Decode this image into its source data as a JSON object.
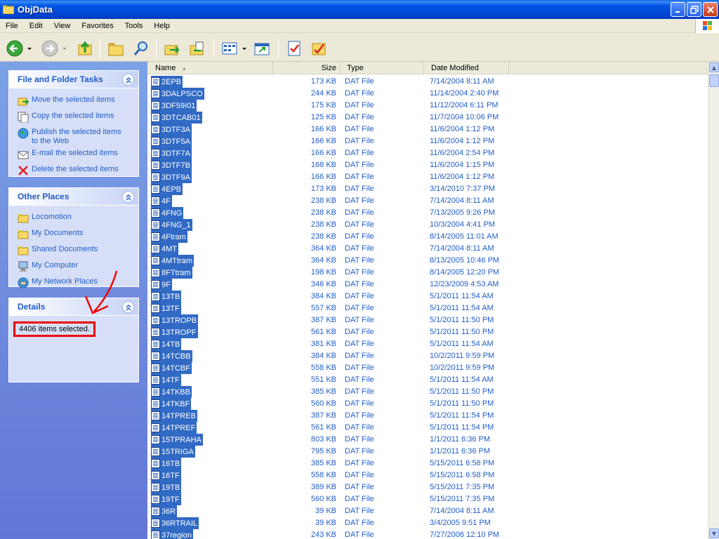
{
  "window": {
    "title": "ObjData"
  },
  "menu": [
    "File",
    "Edit",
    "View",
    "Favorites",
    "Tools",
    "Help"
  ],
  "toolbar": {
    "icons": [
      "back-icon",
      "forward-icon",
      "up-folder-icon",
      "folder-icon",
      "search-icon",
      "move-to-icon",
      "copy-to-icon",
      "views-icon",
      "folder-sync-icon",
      "tasks-icon",
      "favorites-icon"
    ]
  },
  "tasks_panel": {
    "title": "File and Folder Tasks",
    "items": [
      {
        "label": "Move the selected items",
        "icon": "move-icon"
      },
      {
        "label": "Copy the selected items",
        "icon": "copy-icon"
      },
      {
        "label": "Publish the selected items to the Web",
        "icon": "globe-icon"
      },
      {
        "label": "E-mail the selected items",
        "icon": "email-icon"
      },
      {
        "label": "Delete the selected items",
        "icon": "delete-icon"
      }
    ]
  },
  "places_panel": {
    "title": "Other Places",
    "items": [
      {
        "label": "Locomotion",
        "icon": "folder-icon"
      },
      {
        "label": "My Documents",
        "icon": "folder-icon"
      },
      {
        "label": "Shared Documents",
        "icon": "folder-icon"
      },
      {
        "label": "My Computer",
        "icon": "computer-icon"
      },
      {
        "label": "My Network Places",
        "icon": "network-icon"
      }
    ]
  },
  "details_panel": {
    "title": "Details",
    "text": "4406 items selected."
  },
  "columns": {
    "name": "Name",
    "size": "Size",
    "type": "Type",
    "date": "Date Modified"
  },
  "files": [
    {
      "name": "2EPB",
      "size": "173 KB",
      "type": "DAT File",
      "date": "7/14/2004 8:11 AM"
    },
    {
      "name": "3DALPSCO",
      "size": "244 KB",
      "type": "DAT File",
      "date": "11/14/2004 2:40 PM"
    },
    {
      "name": "3DF59I01",
      "size": "175 KB",
      "type": "DAT File",
      "date": "11/12/2004 6:11 PM"
    },
    {
      "name": "3DTCAB01",
      "size": "125 KB",
      "type": "DAT File",
      "date": "11/7/2004 10:06 PM"
    },
    {
      "name": "3DTF3A",
      "size": "166 KB",
      "type": "DAT File",
      "date": "11/6/2004 1:12 PM"
    },
    {
      "name": "3DTF5A",
      "size": "166 KB",
      "type": "DAT File",
      "date": "11/6/2004 1:12 PM"
    },
    {
      "name": "3DTF7A",
      "size": "166 KB",
      "type": "DAT File",
      "date": "11/6/2004 2:54 PM"
    },
    {
      "name": "3DTF7B",
      "size": "168 KB",
      "type": "DAT File",
      "date": "11/6/2004 1:15 PM"
    },
    {
      "name": "3DTF9A",
      "size": "166 KB",
      "type": "DAT File",
      "date": "11/6/2004 1:12 PM"
    },
    {
      "name": "4EPB",
      "size": "173 KB",
      "type": "DAT File",
      "date": "3/14/2010 7:37 PM"
    },
    {
      "name": "4F",
      "size": "238 KB",
      "type": "DAT File",
      "date": "7/14/2004 8:11 AM"
    },
    {
      "name": "4FNG",
      "size": "238 KB",
      "type": "DAT File",
      "date": "7/13/2005 9:26 PM"
    },
    {
      "name": "4FNG_1",
      "size": "238 KB",
      "type": "DAT File",
      "date": "10/3/2004 4:41 PM"
    },
    {
      "name": "4Ftram",
      "size": "238 KB",
      "type": "DAT File",
      "date": "8/14/2005 11:01 AM"
    },
    {
      "name": "4MT",
      "size": "364 KB",
      "type": "DAT File",
      "date": "7/14/2004 8:11 AM"
    },
    {
      "name": "4MTtram",
      "size": "364 KB",
      "type": "DAT File",
      "date": "8/13/2005 10:46 PM"
    },
    {
      "name": "8FTtram",
      "size": "198 KB",
      "type": "DAT File",
      "date": "8/14/2005 12:20 PM"
    },
    {
      "name": "9F",
      "size": "346 KB",
      "type": "DAT File",
      "date": "12/23/2009 4:53 AM"
    },
    {
      "name": "13TB",
      "size": "384 KB",
      "type": "DAT File",
      "date": "5/1/2011 11:54 AM"
    },
    {
      "name": "13TF",
      "size": "557 KB",
      "type": "DAT File",
      "date": "5/1/2011 11:54 AM"
    },
    {
      "name": "13TROPB",
      "size": "387 KB",
      "type": "DAT File",
      "date": "5/1/2011 11:50 PM"
    },
    {
      "name": "13TROPF",
      "size": "561 KB",
      "type": "DAT File",
      "date": "5/1/2011 11:50 PM"
    },
    {
      "name": "14TB",
      "size": "381 KB",
      "type": "DAT File",
      "date": "5/1/2011 11:54 AM"
    },
    {
      "name": "14TCBB",
      "size": "384 KB",
      "type": "DAT File",
      "date": "10/2/2011 9:59 PM"
    },
    {
      "name": "14TCBF",
      "size": "558 KB",
      "type": "DAT File",
      "date": "10/2/2011 9:59 PM"
    },
    {
      "name": "14TF",
      "size": "551 KB",
      "type": "DAT File",
      "date": "5/1/2011 11:54 AM"
    },
    {
      "name": "14TKBB",
      "size": "385 KB",
      "type": "DAT File",
      "date": "5/1/2011 11:50 PM"
    },
    {
      "name": "14TKBF",
      "size": "560 KB",
      "type": "DAT File",
      "date": "5/1/2011 11:50 PM"
    },
    {
      "name": "14TPREB",
      "size": "387 KB",
      "type": "DAT File",
      "date": "5/1/2011 11:54 PM"
    },
    {
      "name": "14TPREF",
      "size": "561 KB",
      "type": "DAT File",
      "date": "5/1/2011 11:54 PM"
    },
    {
      "name": "15TPRAHA",
      "size": "803 KB",
      "type": "DAT File",
      "date": "1/1/2011 6:36 PM"
    },
    {
      "name": "15TRIGA",
      "size": "795 KB",
      "type": "DAT File",
      "date": "1/1/2011 6:36 PM"
    },
    {
      "name": "16TB",
      "size": "385 KB",
      "type": "DAT File",
      "date": "5/15/2011 6:58 PM"
    },
    {
      "name": "16TF",
      "size": "558 KB",
      "type": "DAT File",
      "date": "5/15/2011 6:58 PM"
    },
    {
      "name": "19TB",
      "size": "389 KB",
      "type": "DAT File",
      "date": "5/15/2011 7:35 PM"
    },
    {
      "name": "19TF",
      "size": "560 KB",
      "type": "DAT File",
      "date": "5/15/2011 7:35 PM"
    },
    {
      "name": "36R",
      "size": "39 KB",
      "type": "DAT File",
      "date": "7/14/2004 8:11 AM"
    },
    {
      "name": "36RTRAIL",
      "size": "39 KB",
      "type": "DAT File",
      "date": "3/4/2005 9:51 PM"
    },
    {
      "name": "37region",
      "size": "243 KB",
      "type": "DAT File",
      "date": "7/27/2006 12:10 PM"
    }
  ]
}
